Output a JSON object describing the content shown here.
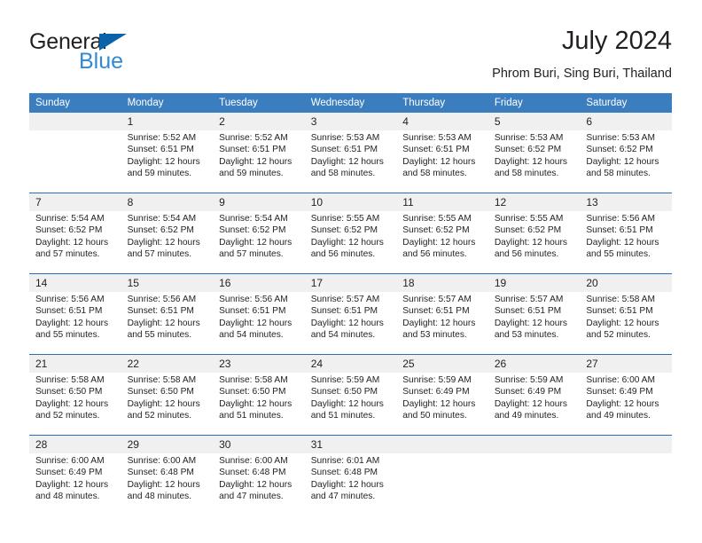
{
  "brand": {
    "name_part1": "General",
    "name_part2": "Blue",
    "triangle_color": "#0a62ab",
    "blue_color": "#2e8ad6"
  },
  "header": {
    "title": "July 2024",
    "subtitle": "Phrom Buri, Sing Buri, Thailand",
    "header_bg_color": "#3b7ec0",
    "daynum_bg_color": "#f0f0f0",
    "week_rule_color": "#2a6fb5"
  },
  "weekday_headers": [
    "Sunday",
    "Monday",
    "Tuesday",
    "Wednesday",
    "Thursday",
    "Friday",
    "Saturday"
  ],
  "weeks": [
    {
      "days": [
        {
          "num": "",
          "sunrise": "",
          "sunset": "",
          "daylight_l1": "",
          "daylight_l2": ""
        },
        {
          "num": "1",
          "sunrise": "Sunrise: 5:52 AM",
          "sunset": "Sunset: 6:51 PM",
          "daylight_l1": "Daylight: 12 hours",
          "daylight_l2": "and 59 minutes."
        },
        {
          "num": "2",
          "sunrise": "Sunrise: 5:52 AM",
          "sunset": "Sunset: 6:51 PM",
          "daylight_l1": "Daylight: 12 hours",
          "daylight_l2": "and 59 minutes."
        },
        {
          "num": "3",
          "sunrise": "Sunrise: 5:53 AM",
          "sunset": "Sunset: 6:51 PM",
          "daylight_l1": "Daylight: 12 hours",
          "daylight_l2": "and 58 minutes."
        },
        {
          "num": "4",
          "sunrise": "Sunrise: 5:53 AM",
          "sunset": "Sunset: 6:51 PM",
          "daylight_l1": "Daylight: 12 hours",
          "daylight_l2": "and 58 minutes."
        },
        {
          "num": "5",
          "sunrise": "Sunrise: 5:53 AM",
          "sunset": "Sunset: 6:52 PM",
          "daylight_l1": "Daylight: 12 hours",
          "daylight_l2": "and 58 minutes."
        },
        {
          "num": "6",
          "sunrise": "Sunrise: 5:53 AM",
          "sunset": "Sunset: 6:52 PM",
          "daylight_l1": "Daylight: 12 hours",
          "daylight_l2": "and 58 minutes."
        }
      ]
    },
    {
      "days": [
        {
          "num": "7",
          "sunrise": "Sunrise: 5:54 AM",
          "sunset": "Sunset: 6:52 PM",
          "daylight_l1": "Daylight: 12 hours",
          "daylight_l2": "and 57 minutes."
        },
        {
          "num": "8",
          "sunrise": "Sunrise: 5:54 AM",
          "sunset": "Sunset: 6:52 PM",
          "daylight_l1": "Daylight: 12 hours",
          "daylight_l2": "and 57 minutes."
        },
        {
          "num": "9",
          "sunrise": "Sunrise: 5:54 AM",
          "sunset": "Sunset: 6:52 PM",
          "daylight_l1": "Daylight: 12 hours",
          "daylight_l2": "and 57 minutes."
        },
        {
          "num": "10",
          "sunrise": "Sunrise: 5:55 AM",
          "sunset": "Sunset: 6:52 PM",
          "daylight_l1": "Daylight: 12 hours",
          "daylight_l2": "and 56 minutes."
        },
        {
          "num": "11",
          "sunrise": "Sunrise: 5:55 AM",
          "sunset": "Sunset: 6:52 PM",
          "daylight_l1": "Daylight: 12 hours",
          "daylight_l2": "and 56 minutes."
        },
        {
          "num": "12",
          "sunrise": "Sunrise: 5:55 AM",
          "sunset": "Sunset: 6:52 PM",
          "daylight_l1": "Daylight: 12 hours",
          "daylight_l2": "and 56 minutes."
        },
        {
          "num": "13",
          "sunrise": "Sunrise: 5:56 AM",
          "sunset": "Sunset: 6:51 PM",
          "daylight_l1": "Daylight: 12 hours",
          "daylight_l2": "and 55 minutes."
        }
      ]
    },
    {
      "days": [
        {
          "num": "14",
          "sunrise": "Sunrise: 5:56 AM",
          "sunset": "Sunset: 6:51 PM",
          "daylight_l1": "Daylight: 12 hours",
          "daylight_l2": "and 55 minutes."
        },
        {
          "num": "15",
          "sunrise": "Sunrise: 5:56 AM",
          "sunset": "Sunset: 6:51 PM",
          "daylight_l1": "Daylight: 12 hours",
          "daylight_l2": "and 55 minutes."
        },
        {
          "num": "16",
          "sunrise": "Sunrise: 5:56 AM",
          "sunset": "Sunset: 6:51 PM",
          "daylight_l1": "Daylight: 12 hours",
          "daylight_l2": "and 54 minutes."
        },
        {
          "num": "17",
          "sunrise": "Sunrise: 5:57 AM",
          "sunset": "Sunset: 6:51 PM",
          "daylight_l1": "Daylight: 12 hours",
          "daylight_l2": "and 54 minutes."
        },
        {
          "num": "18",
          "sunrise": "Sunrise: 5:57 AM",
          "sunset": "Sunset: 6:51 PM",
          "daylight_l1": "Daylight: 12 hours",
          "daylight_l2": "and 53 minutes."
        },
        {
          "num": "19",
          "sunrise": "Sunrise: 5:57 AM",
          "sunset": "Sunset: 6:51 PM",
          "daylight_l1": "Daylight: 12 hours",
          "daylight_l2": "and 53 minutes."
        },
        {
          "num": "20",
          "sunrise": "Sunrise: 5:58 AM",
          "sunset": "Sunset: 6:51 PM",
          "daylight_l1": "Daylight: 12 hours",
          "daylight_l2": "and 52 minutes."
        }
      ]
    },
    {
      "days": [
        {
          "num": "21",
          "sunrise": "Sunrise: 5:58 AM",
          "sunset": "Sunset: 6:50 PM",
          "daylight_l1": "Daylight: 12 hours",
          "daylight_l2": "and 52 minutes."
        },
        {
          "num": "22",
          "sunrise": "Sunrise: 5:58 AM",
          "sunset": "Sunset: 6:50 PM",
          "daylight_l1": "Daylight: 12 hours",
          "daylight_l2": "and 52 minutes."
        },
        {
          "num": "23",
          "sunrise": "Sunrise: 5:58 AM",
          "sunset": "Sunset: 6:50 PM",
          "daylight_l1": "Daylight: 12 hours",
          "daylight_l2": "and 51 minutes."
        },
        {
          "num": "24",
          "sunrise": "Sunrise: 5:59 AM",
          "sunset": "Sunset: 6:50 PM",
          "daylight_l1": "Daylight: 12 hours",
          "daylight_l2": "and 51 minutes."
        },
        {
          "num": "25",
          "sunrise": "Sunrise: 5:59 AM",
          "sunset": "Sunset: 6:49 PM",
          "daylight_l1": "Daylight: 12 hours",
          "daylight_l2": "and 50 minutes."
        },
        {
          "num": "26",
          "sunrise": "Sunrise: 5:59 AM",
          "sunset": "Sunset: 6:49 PM",
          "daylight_l1": "Daylight: 12 hours",
          "daylight_l2": "and 49 minutes."
        },
        {
          "num": "27",
          "sunrise": "Sunrise: 6:00 AM",
          "sunset": "Sunset: 6:49 PM",
          "daylight_l1": "Daylight: 12 hours",
          "daylight_l2": "and 49 minutes."
        }
      ]
    },
    {
      "days": [
        {
          "num": "28",
          "sunrise": "Sunrise: 6:00 AM",
          "sunset": "Sunset: 6:49 PM",
          "daylight_l1": "Daylight: 12 hours",
          "daylight_l2": "and 48 minutes."
        },
        {
          "num": "29",
          "sunrise": "Sunrise: 6:00 AM",
          "sunset": "Sunset: 6:48 PM",
          "daylight_l1": "Daylight: 12 hours",
          "daylight_l2": "and 48 minutes."
        },
        {
          "num": "30",
          "sunrise": "Sunrise: 6:00 AM",
          "sunset": "Sunset: 6:48 PM",
          "daylight_l1": "Daylight: 12 hours",
          "daylight_l2": "and 47 minutes."
        },
        {
          "num": "31",
          "sunrise": "Sunrise: 6:01 AM",
          "sunset": "Sunset: 6:48 PM",
          "daylight_l1": "Daylight: 12 hours",
          "daylight_l2": "and 47 minutes."
        },
        {
          "num": "",
          "sunrise": "",
          "sunset": "",
          "daylight_l1": "",
          "daylight_l2": ""
        },
        {
          "num": "",
          "sunrise": "",
          "sunset": "",
          "daylight_l1": "",
          "daylight_l2": ""
        },
        {
          "num": "",
          "sunrise": "",
          "sunset": "",
          "daylight_l1": "",
          "daylight_l2": ""
        }
      ]
    }
  ]
}
